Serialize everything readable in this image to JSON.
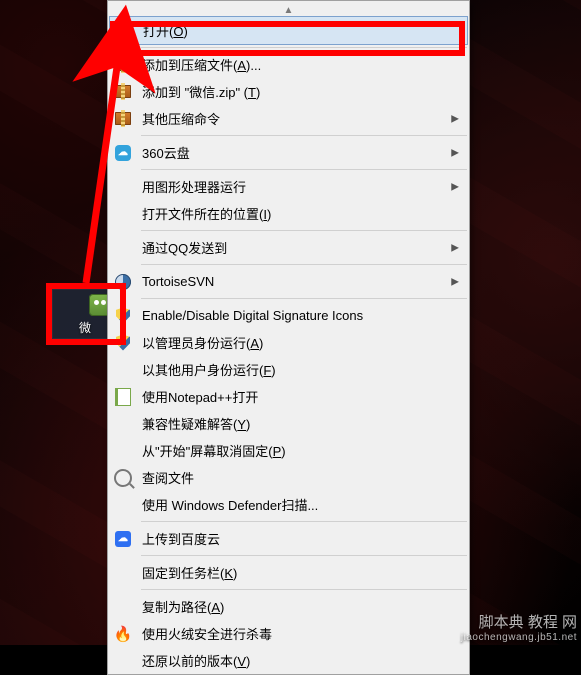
{
  "desktop_icon": {
    "label": "微"
  },
  "scroll_up_glyph": "▲",
  "menu": [
    {
      "kind": "item",
      "label": "打开(",
      "access": "O",
      "tail": ")",
      "highlighted": true
    },
    {
      "kind": "sep"
    },
    {
      "kind": "item",
      "label": "添加到压缩文件(",
      "access": "A",
      "tail": ")...",
      "icon": "archive"
    },
    {
      "kind": "item",
      "label": "添加到 \"微信.zip\" (",
      "access": "T",
      "tail": ")",
      "icon": "archive"
    },
    {
      "kind": "item",
      "label": "其他压缩命令",
      "icon": "archive",
      "submenu": true
    },
    {
      "kind": "sep"
    },
    {
      "kind": "item",
      "label": "360云盘",
      "icon": "360",
      "submenu": true
    },
    {
      "kind": "sep"
    },
    {
      "kind": "item",
      "label": "用图形处理器运行",
      "submenu": true
    },
    {
      "kind": "item",
      "label": "打开文件所在的位置(",
      "access": "I",
      "tail": ")"
    },
    {
      "kind": "sep"
    },
    {
      "kind": "item",
      "label": "通过QQ发送到",
      "submenu": true
    },
    {
      "kind": "sep"
    },
    {
      "kind": "item",
      "label": "TortoiseSVN",
      "icon": "svn",
      "submenu": true
    },
    {
      "kind": "sep"
    },
    {
      "kind": "item",
      "label": "Enable/Disable Digital Signature Icons",
      "icon": "shield"
    },
    {
      "kind": "item",
      "label": "以管理员身份运行(",
      "access": "A",
      "tail": ")",
      "icon": "shield"
    },
    {
      "kind": "item",
      "label": "以其他用户身份运行(",
      "access": "F",
      "tail": ")"
    },
    {
      "kind": "item",
      "label": "使用Notepad++打开",
      "icon": "note"
    },
    {
      "kind": "item",
      "label": "兼容性疑难解答(",
      "access": "Y",
      "tail": ")"
    },
    {
      "kind": "item",
      "label": "从\"开始\"屏幕取消固定(",
      "access": "P",
      "tail": ")"
    },
    {
      "kind": "item",
      "label": "查阅文件",
      "icon": "search"
    },
    {
      "kind": "item",
      "label": "使用 Windows Defender扫描..."
    },
    {
      "kind": "sep"
    },
    {
      "kind": "item",
      "label": "上传到百度云",
      "icon": "baidu"
    },
    {
      "kind": "sep"
    },
    {
      "kind": "item",
      "label": "固定到任务栏(",
      "access": "K",
      "tail": ")"
    },
    {
      "kind": "sep"
    },
    {
      "kind": "item",
      "label": "复制为路径(",
      "access": "A",
      "tail": ")"
    },
    {
      "kind": "item",
      "label": "使用火绒安全进行杀毒",
      "icon": "fire"
    },
    {
      "kind": "item",
      "label": "还原以前的版本(",
      "access": "V",
      "tail": ")"
    }
  ],
  "submenu_glyph": "▶",
  "watermark": {
    "line1": "脚本典 教程 网",
    "line2": "jiaochengwang.jb51.net"
  },
  "icons": {
    "archive": "archive-icon",
    "360": "360-icon",
    "svn": "tortoisesvn-icon",
    "shield": "shield-icon",
    "note": "notepad-icon",
    "search": "search-icon",
    "baidu": "baidu-cloud-icon",
    "fire": "huorong-icon"
  }
}
